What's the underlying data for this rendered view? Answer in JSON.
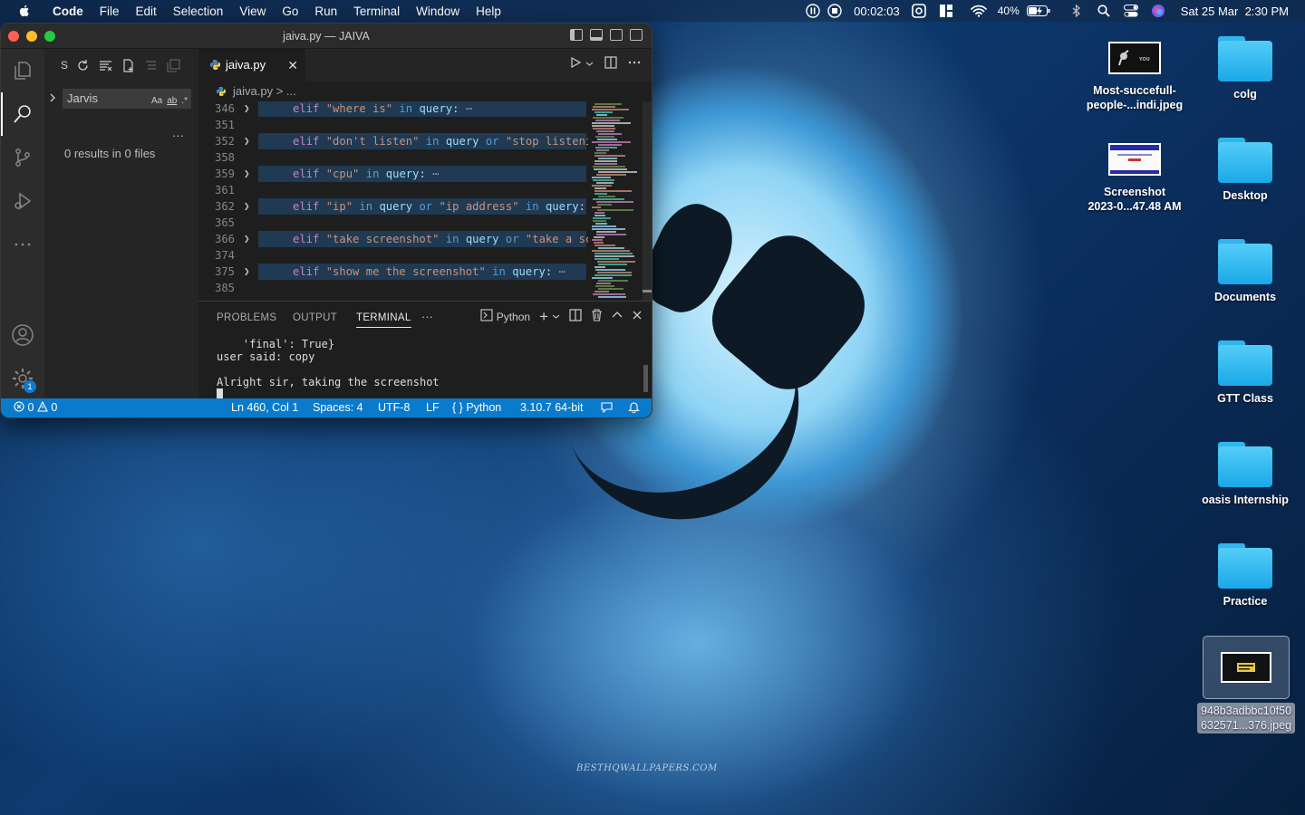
{
  "menubar": {
    "app_name": "Code",
    "items": [
      "File",
      "Edit",
      "Selection",
      "View",
      "Go",
      "Run",
      "Terminal",
      "Window",
      "Help"
    ],
    "timer": "00:02:03",
    "battery": "40%",
    "datetime": "Sat 25 Mar  2:30 PM"
  },
  "desktop": {
    "files": [
      {
        "label": "Most-succefull-people-...indi.jpeg",
        "line1": "Most-succefull-",
        "line2": "people-...indi.jpeg"
      },
      {
        "label": "Screenshot 2023-0...47.48 AM",
        "line1": "Screenshot",
        "line2": "2023-0...47.48 AM"
      }
    ],
    "folders": [
      "colg",
      "Desktop",
      "Documents",
      "GTT Class",
      "oasis Internship",
      "Practice"
    ],
    "selected_file": {
      "line1": "948b3adbbc10f50",
      "line2": "632571...376.jpeg"
    },
    "wallpaper_credit": "BESTHQWALLPAPERS.COM"
  },
  "window": {
    "title": "jaiva.py — JAIVA",
    "sidebar": {
      "toolbar_label": "S",
      "search_value": "Jarvis",
      "opt_case": "Aa",
      "opt_word": "ab",
      "opt_regex": ".*",
      "more": "···",
      "results": "0 results in 0 files"
    },
    "tab": {
      "name": "jaiva.py",
      "close": "✕"
    },
    "breadcrumb": {
      "file": "jaiva.py",
      "sep": ">",
      "rest": "..."
    },
    "code_lines": [
      {
        "num": "346",
        "fold": true,
        "code": "elif \"where is\" in query:"
      },
      {
        "num": "351",
        "fold": false,
        "code": ""
      },
      {
        "num": "352",
        "fold": true,
        "code": "elif \"don't listen\" in query or \"stop listeni"
      },
      {
        "num": "358",
        "fold": false,
        "code": ""
      },
      {
        "num": "359",
        "fold": true,
        "code": "elif \"cpu\" in query:"
      },
      {
        "num": "361",
        "fold": false,
        "code": ""
      },
      {
        "num": "362",
        "fold": true,
        "code": "elif \"ip\" in query or \"ip address\" in query:"
      },
      {
        "num": "365",
        "fold": false,
        "code": ""
      },
      {
        "num": "366",
        "fold": true,
        "code": "elif \"take screenshot\" in query or \"take a sc"
      },
      {
        "num": "374",
        "fold": false,
        "code": ""
      },
      {
        "num": "375",
        "fold": true,
        "code": "elif \"show me the screenshot\" in query:"
      },
      {
        "num": "385",
        "fold": false,
        "code": ""
      }
    ],
    "panel": {
      "tabs": [
        "PROBLEMS",
        "OUTPUT",
        "TERMINAL"
      ],
      "active_tab": "TERMINAL",
      "shell": "Python",
      "terminal_lines": [
        "    'final': True}",
        "user said: copy",
        "",
        "Alright sir, taking the screenshot"
      ]
    },
    "status": {
      "errors": "0",
      "warnings": "0",
      "position": "Ln 460, Col 1",
      "spaces": "Spaces: 4",
      "encoding": "UTF-8",
      "eol": "LF",
      "language": "Python",
      "interpreter": "3.10.7 64-bit"
    },
    "settings_badge": "1"
  }
}
